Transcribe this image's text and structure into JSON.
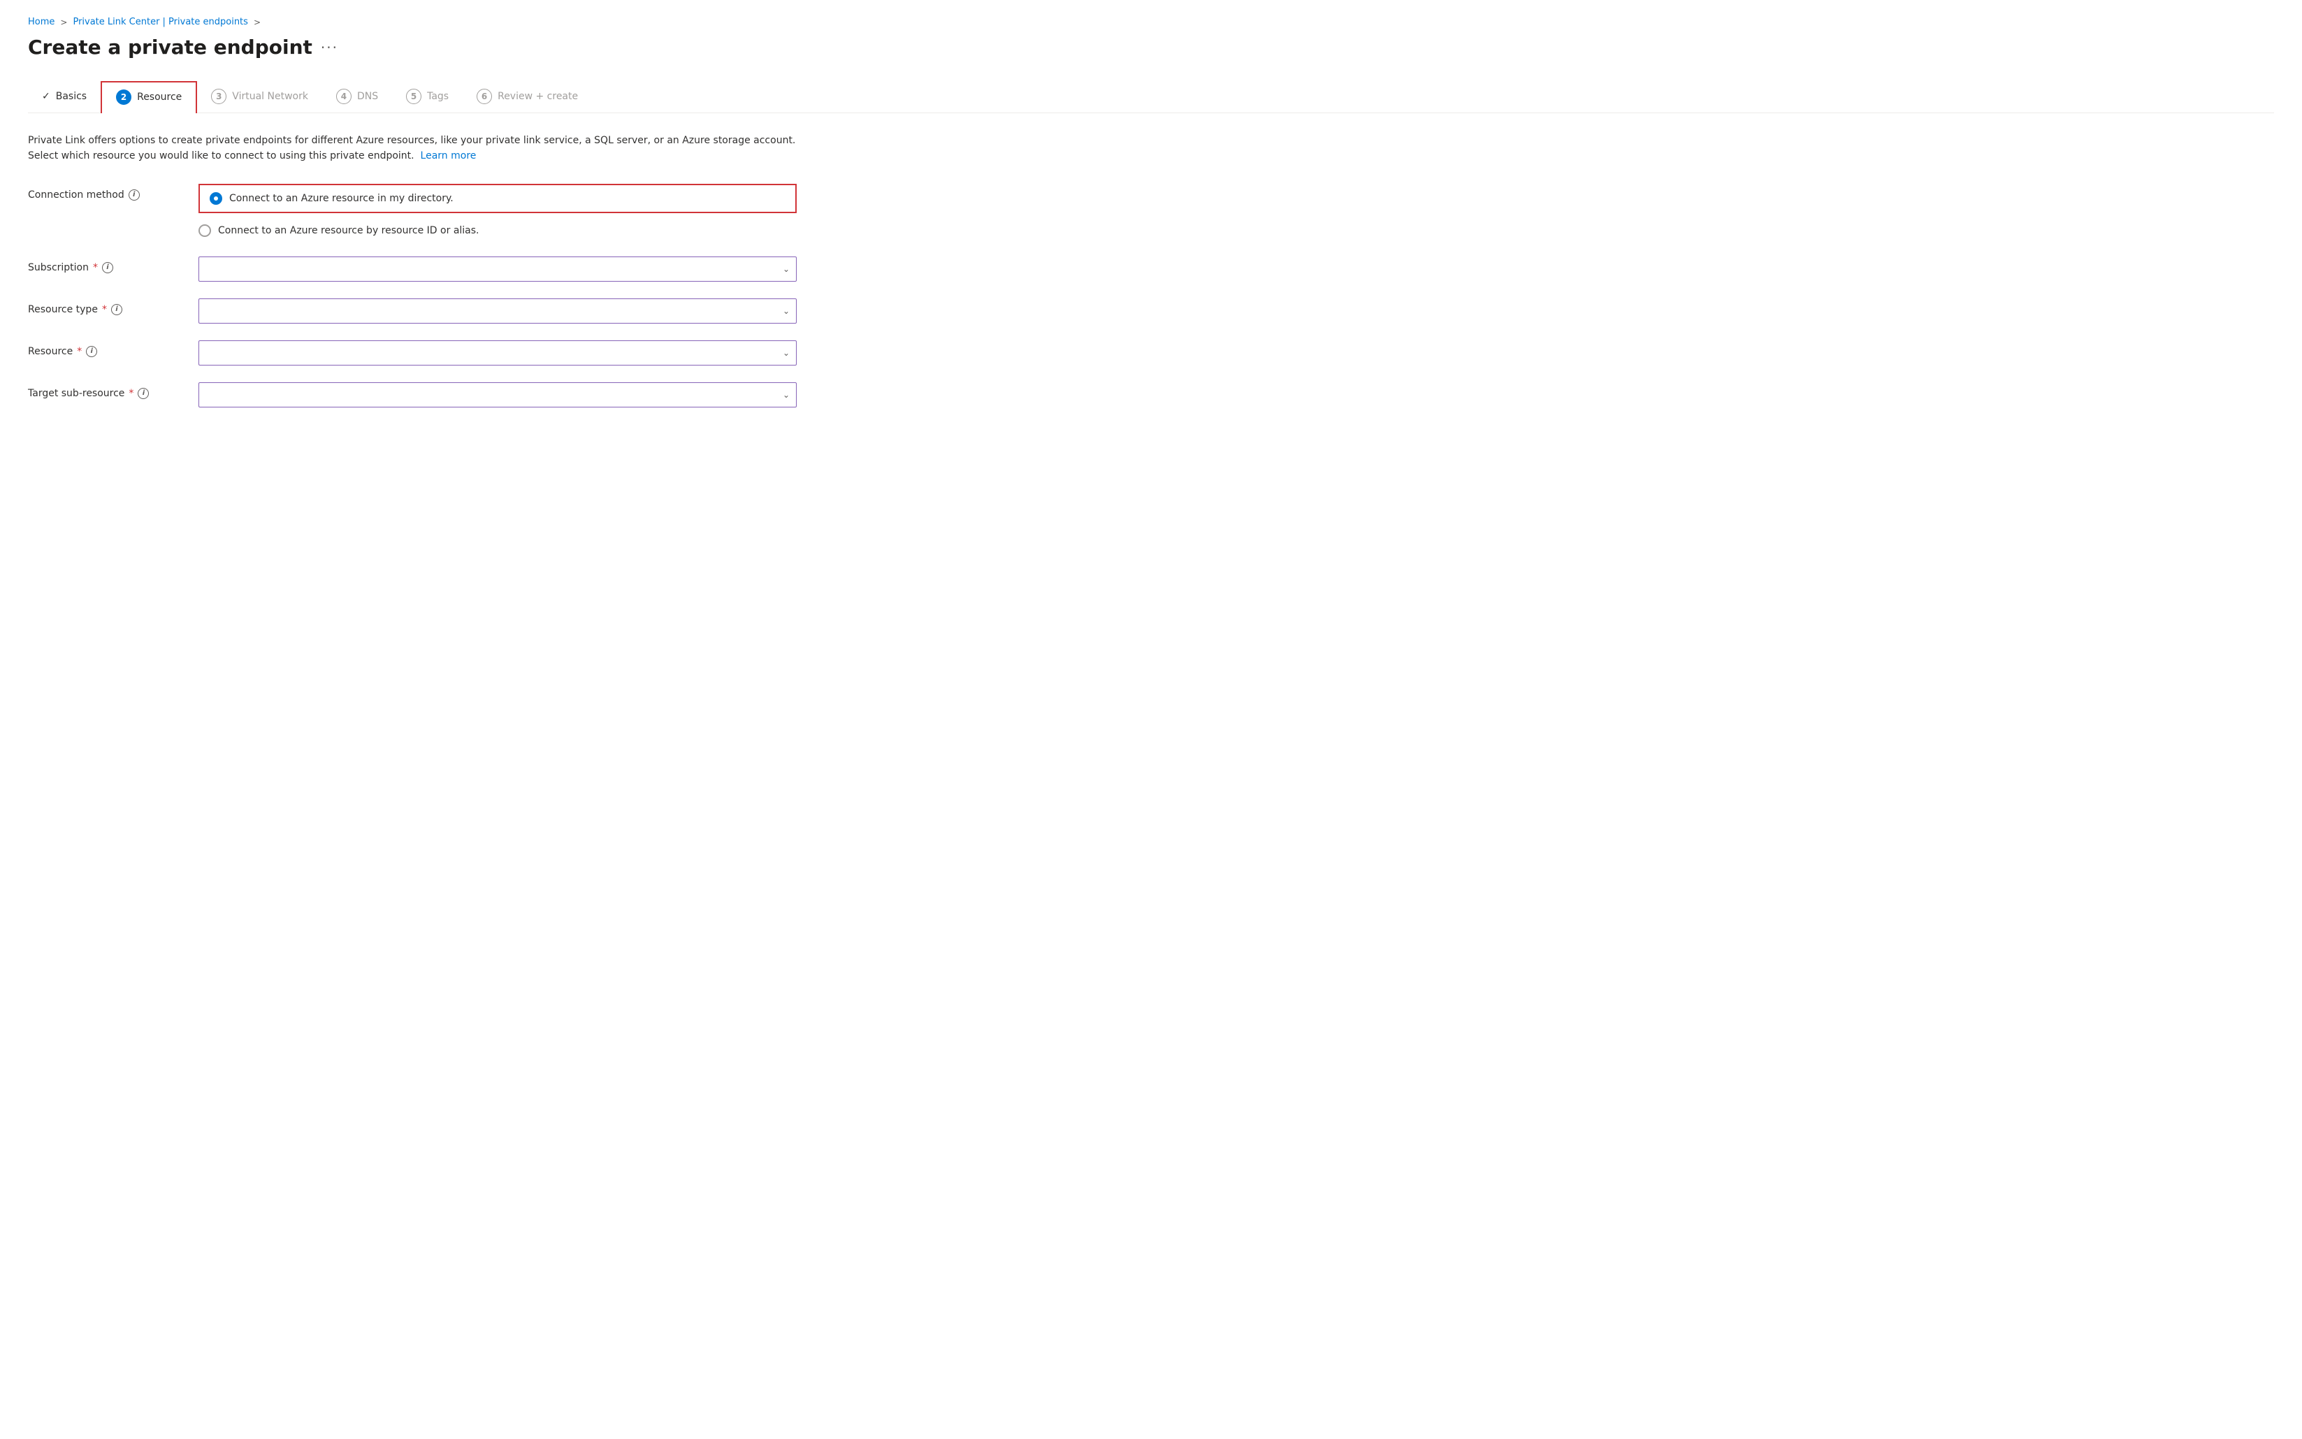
{
  "breadcrumb": {
    "items": [
      {
        "label": "Home",
        "href": "#"
      },
      {
        "label": "Private Link Center | Private endpoints",
        "href": "#"
      }
    ],
    "separator": ">"
  },
  "page": {
    "title": "Create a private endpoint",
    "menu_icon": "···"
  },
  "wizard": {
    "tabs": [
      {
        "number": "✓",
        "label": "Basics",
        "state": "completed",
        "step": 1
      },
      {
        "number": "2",
        "label": "Resource",
        "state": "active",
        "step": 2
      },
      {
        "number": "3",
        "label": "Virtual Network",
        "state": "inactive",
        "step": 3
      },
      {
        "number": "4",
        "label": "DNS",
        "state": "inactive",
        "step": 4
      },
      {
        "number": "5",
        "label": "Tags",
        "state": "inactive",
        "step": 5
      },
      {
        "number": "6",
        "label": "Review + create",
        "state": "inactive",
        "step": 6
      }
    ]
  },
  "description": {
    "text_part1": "Private Link offers options to create private endpoints for different Azure resources, like your private link service, a SQL server, or an Azure storage account. Select which resource you would like to connect to using this private endpoint.",
    "learn_more_label": "Learn more"
  },
  "form": {
    "connection_method": {
      "label": "Connection method",
      "info": "i",
      "options": [
        {
          "label": "Connect to an Azure resource in my directory.",
          "checked": true
        },
        {
          "label": "Connect to an Azure resource by resource ID or alias.",
          "checked": false
        }
      ]
    },
    "subscription": {
      "label": "Subscription",
      "required": true,
      "info": "i",
      "value": "",
      "placeholder": ""
    },
    "resource_type": {
      "label": "Resource type",
      "required": true,
      "info": "i",
      "value": "",
      "placeholder": ""
    },
    "resource": {
      "label": "Resource",
      "required": true,
      "info": "i",
      "value": "",
      "placeholder": ""
    },
    "target_sub_resource": {
      "label": "Target sub-resource",
      "required": true,
      "info": "i",
      "value": "",
      "placeholder": ""
    }
  }
}
